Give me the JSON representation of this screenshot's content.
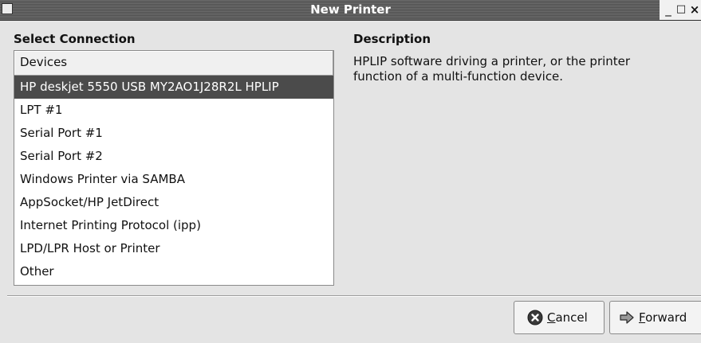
{
  "window": {
    "title": "New Printer"
  },
  "left": {
    "heading": "Select Connection",
    "list": {
      "header": "Devices",
      "selected_index": 0,
      "items": [
        "HP deskjet 5550 USB MY2AO1J28R2L HPLIP",
        "LPT #1",
        "Serial Port #1",
        "Serial Port #2",
        "Windows Printer via SAMBA",
        "AppSocket/HP JetDirect",
        "Internet Printing Protocol (ipp)",
        "LPD/LPR Host or Printer",
        "Other"
      ]
    }
  },
  "right": {
    "heading": "Description",
    "text": "HPLIP software driving a printer, or the printer function of a multi-function device."
  },
  "buttons": {
    "cancel": {
      "accel": "C",
      "rest": "ancel",
      "icon": "cancel-icon"
    },
    "forward": {
      "accel": "F",
      "rest": "orward",
      "icon": "forward-arrow-icon"
    }
  }
}
